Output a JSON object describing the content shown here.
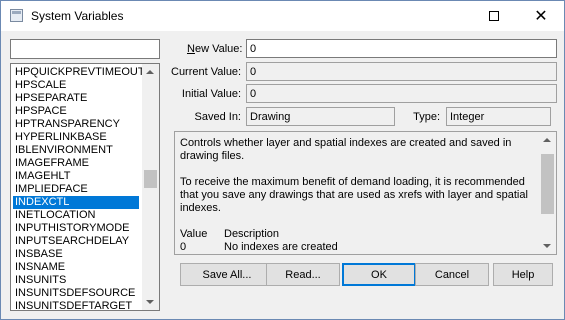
{
  "window": {
    "title": "System Variables",
    "close_glyph": "✕"
  },
  "search": {
    "value": ""
  },
  "variables": {
    "items": [
      "HPQUICKPREVTIMEOUT",
      "HPSCALE",
      "HPSEPARATE",
      "HPSPACE",
      "HPTRANSPARENCY",
      "HYPERLINKBASE",
      "IBLENVIRONMENT",
      "IMAGEFRAME",
      "IMAGEHLT",
      "IMPLIEDFACE",
      "INDEXCTL",
      "INETLOCATION",
      "INPUTHISTORYMODE",
      "INPUTSEARCHDELAY",
      "INSBASE",
      "INSNAME",
      "INSUNITS",
      "INSUNITSDEFSOURCE",
      "INSUNITSDEFTARGET"
    ],
    "selected": "INDEXCTL",
    "scroll_position": 0.46
  },
  "fields": {
    "new_value_label": "New Value:",
    "new_value": "0",
    "current_value_label": "Current Value:",
    "current_value": "0",
    "initial_value_label": "Initial Value:",
    "initial_value": "0",
    "saved_in_label": "Saved In:",
    "saved_in": "Drawing",
    "type_label": "Type:",
    "type": "Integer"
  },
  "description": {
    "para1": "Controls whether layer and spatial indexes are created and saved in drawing files.",
    "para2": "To receive the maximum benefit of demand loading, it is recommended that you save any drawings that are used as xrefs with layer and spatial indexes.",
    "value_header": "Value",
    "description_header": "Description",
    "rows": [
      {
        "value": "0",
        "description": "No indexes are created"
      }
    ]
  },
  "buttons": {
    "save_all": "Save All...",
    "read": "Read...",
    "ok": "OK",
    "cancel": "Cancel",
    "help": "Help"
  }
}
